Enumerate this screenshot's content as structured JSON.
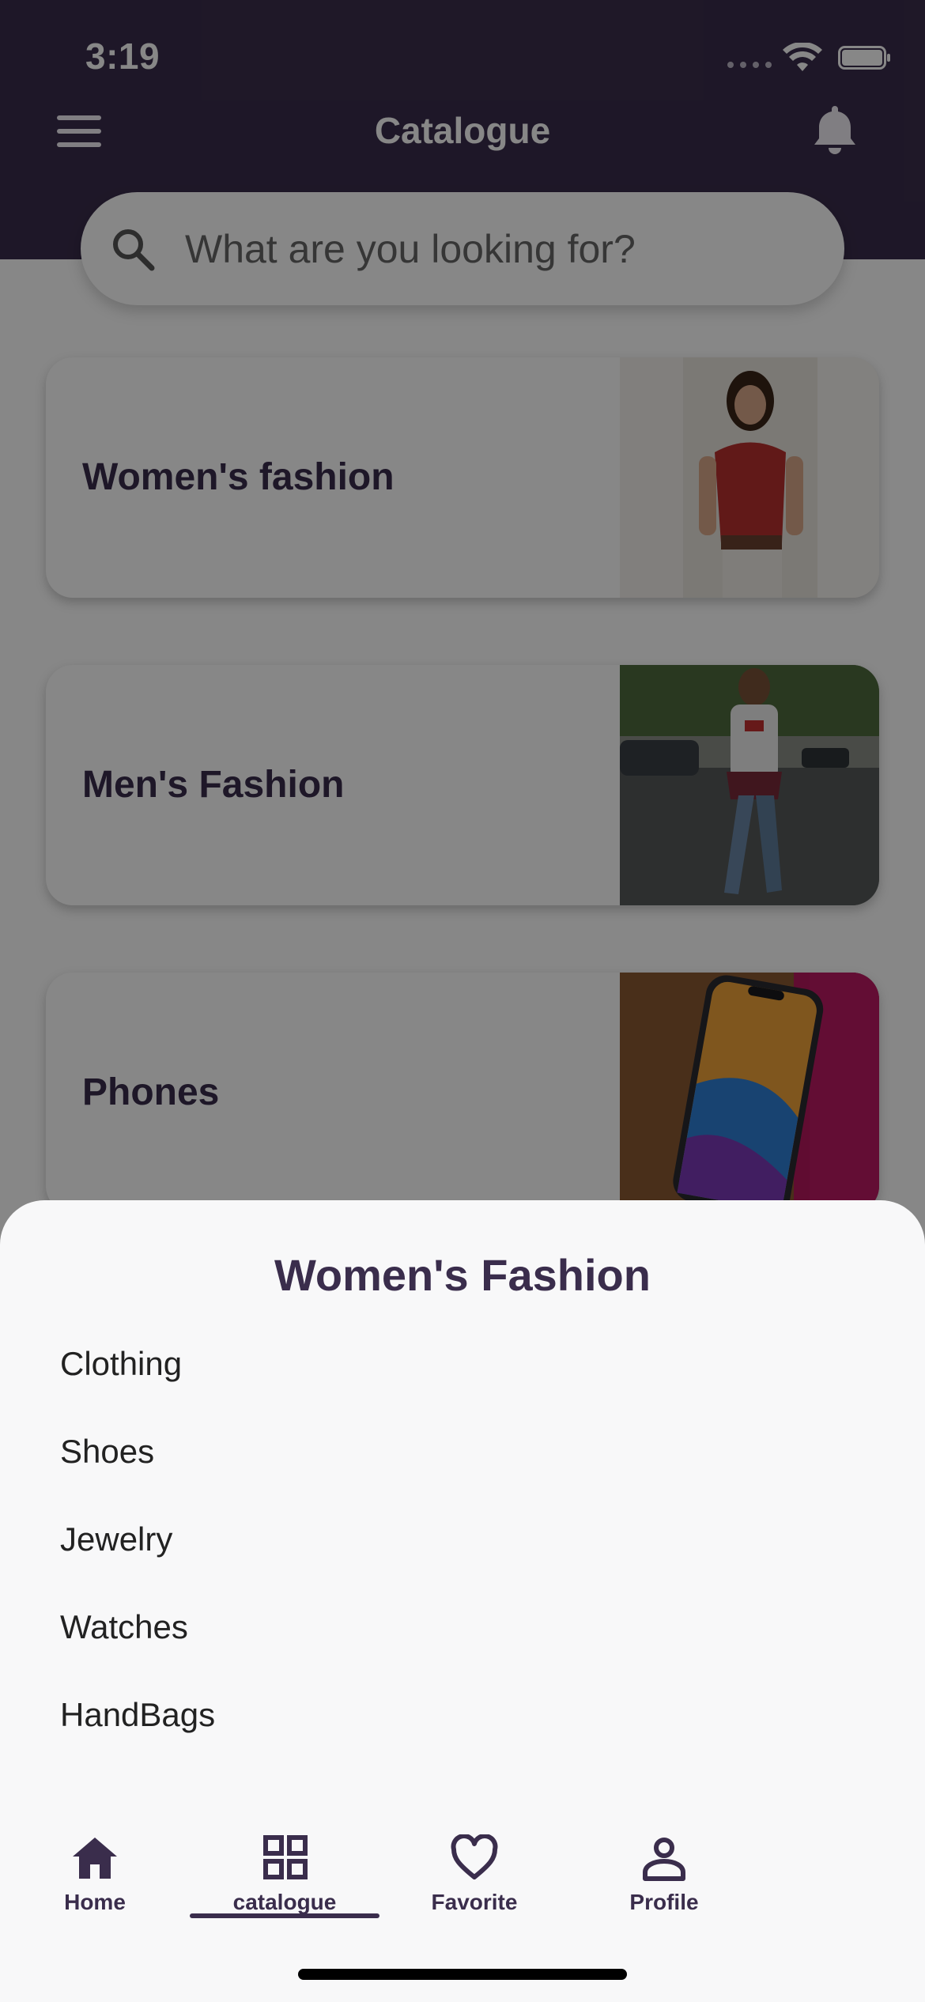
{
  "status_bar": {
    "time": "3:19"
  },
  "header": {
    "title": "Catalogue",
    "menu_icon": "hamburger-menu-icon",
    "bell_icon": "bell-icon",
    "background": "#3a2d4c"
  },
  "search": {
    "placeholder": "What are you looking for?",
    "value": "",
    "icon": "search-icon"
  },
  "categories": [
    {
      "label": "Women's fashion",
      "image": "woman-in-red-top-photo"
    },
    {
      "label": "Men's Fashion",
      "image": "man-on-street-photo"
    },
    {
      "label": "Phones",
      "image": "smartphone-photo"
    }
  ],
  "sheet": {
    "title": "Women's Fashion",
    "items": [
      "Clothing",
      "Shoes",
      "Jewelry",
      "Watches",
      "HandBags"
    ]
  },
  "bottom_nav": {
    "items": [
      {
        "label": "Home",
        "icon": "home-icon"
      },
      {
        "label": "catalogue",
        "icon": "grid-icon"
      },
      {
        "label": "Favorite",
        "icon": "heart-icon"
      },
      {
        "label": "Profile",
        "icon": "person-icon"
      }
    ],
    "active": "catalogue"
  },
  "colors": {
    "primary": "#3a2d4c",
    "sheet": "#f8f8f9"
  }
}
